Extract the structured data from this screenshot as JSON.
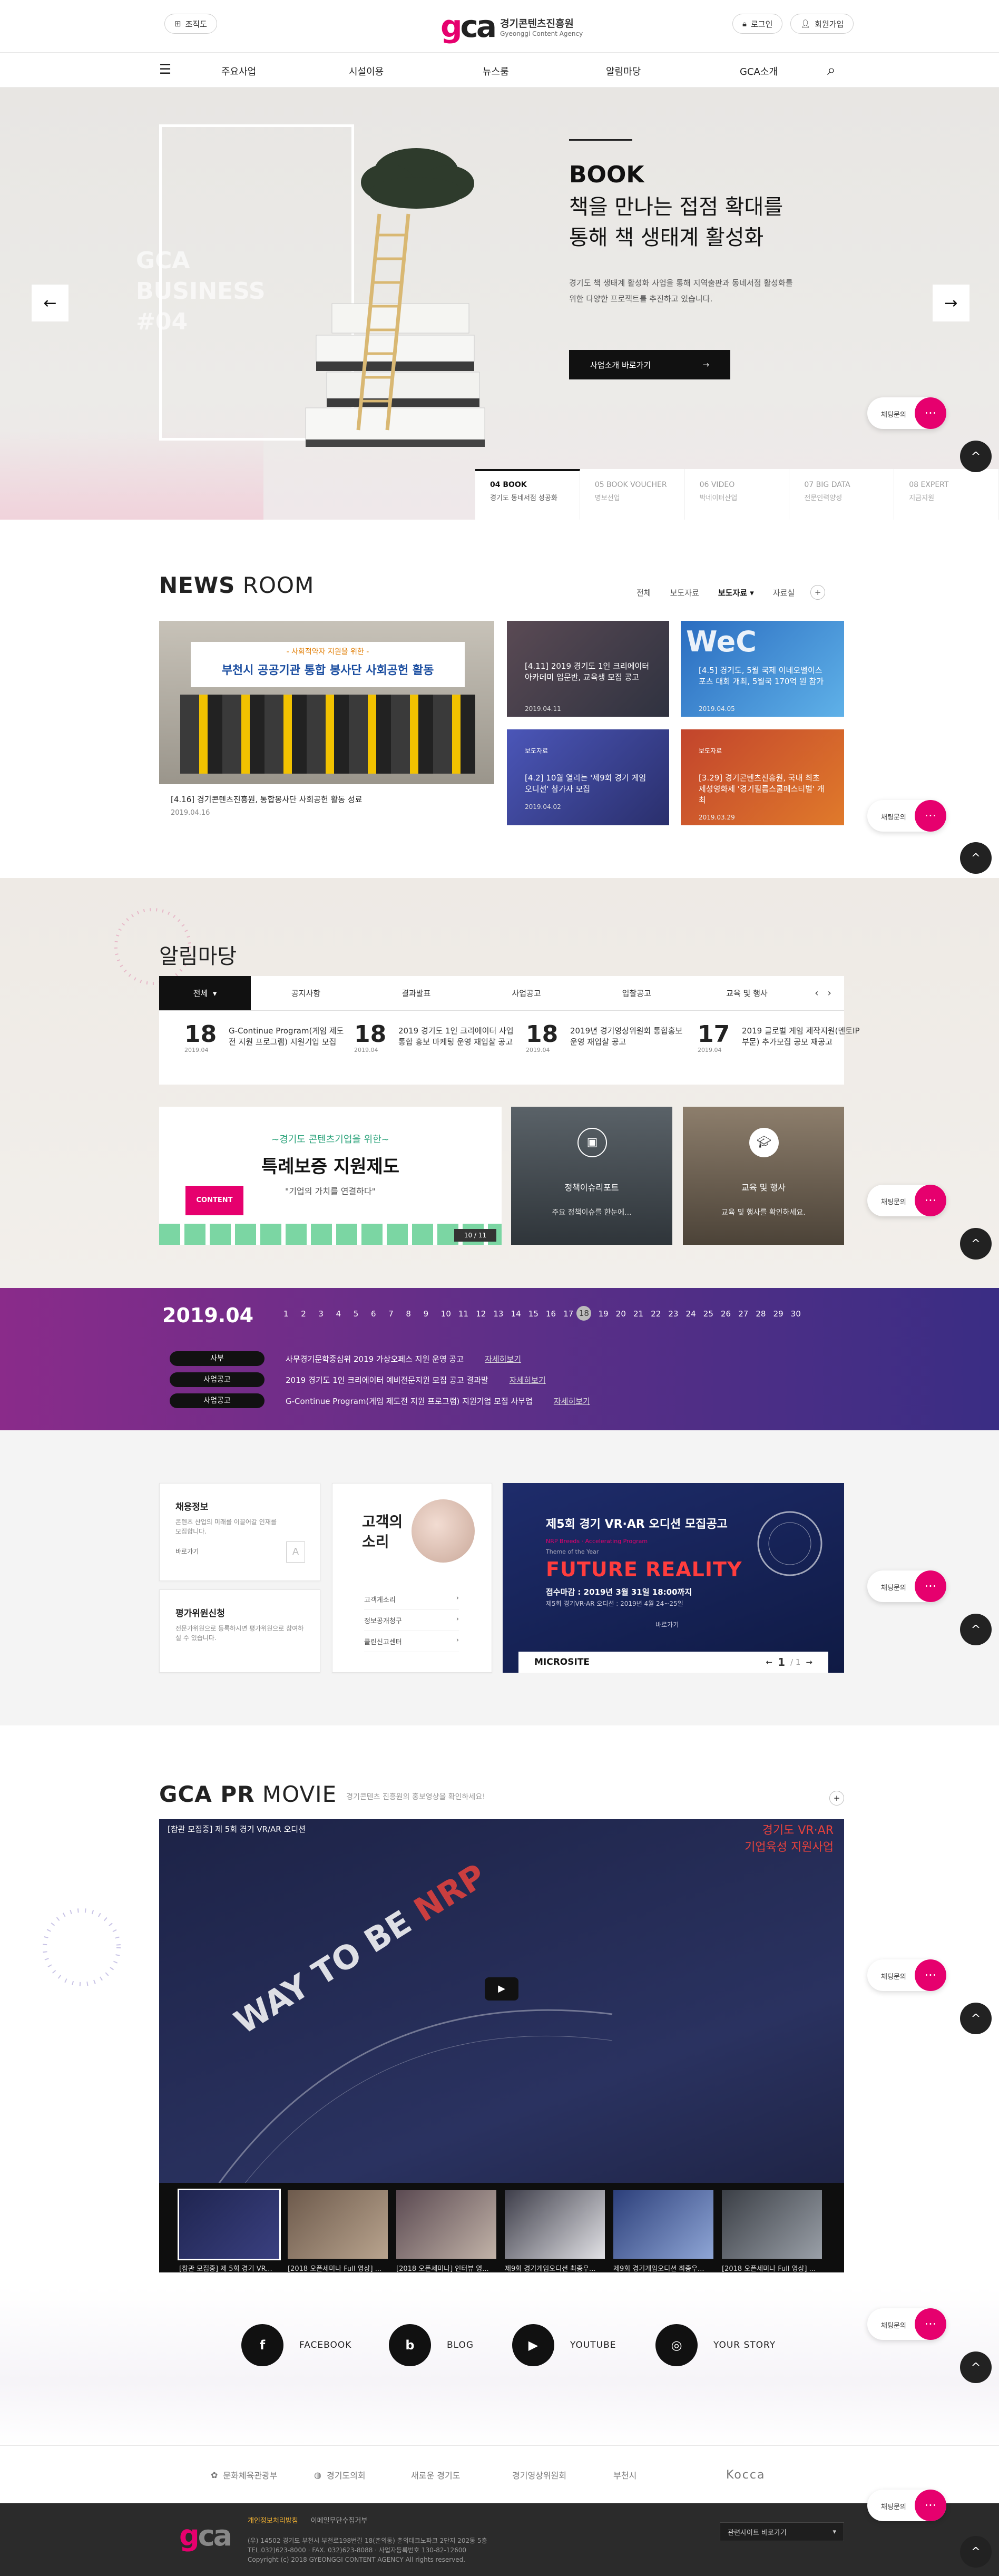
{
  "header": {
    "sitemap_label": "조직도",
    "logo_mark_g": "g",
    "logo_mark_rest": "ca",
    "logo_name": "경기콘텐츠진흥원",
    "logo_sub": "Gyeonggi Content Agency",
    "login_label": "로그인",
    "join_label": "회원가입"
  },
  "gnb": {
    "items": [
      {
        "label": "주요사업"
      },
      {
        "label": "시설이용"
      },
      {
        "label": "뉴스룸"
      },
      {
        "label": "알림마당"
      },
      {
        "label": "GCA소개"
      }
    ]
  },
  "hero": {
    "business_line1": "GCA",
    "business_line2": "BUSINESS",
    "business_line3": "#04",
    "title_en": "BOOK",
    "title_ko_1": "책을 만나는 접점 확대를",
    "title_ko_2": "통해 책 생태계 활성화",
    "desc_1": "경기도 책 생태계 활성화 사업을 통해 지역출판과 동네서점 활성화를",
    "desc_2": "위한 다양한 프로젝트를 추진하고 있습니다.",
    "cta_label": "사업소개 바로가기",
    "prev_icon": "←",
    "next_icon": "→",
    "tabs": [
      {
        "num": "04 BOOK",
        "sub": "경기도 동네서점 성공화"
      },
      {
        "num": "05 BOOK VOUCHER",
        "sub": "명보선업"
      },
      {
        "num": "06 VIDEO",
        "sub": "박네이터산업"
      },
      {
        "num": "07 BIG DATA",
        "sub": "전문인력양성"
      },
      {
        "num": "08 EXPERT",
        "sub": "지금지원"
      }
    ]
  },
  "floating": {
    "chat_label": "채팅문의",
    "chat_icon": "···",
    "top_icon": "^"
  },
  "news": {
    "title_bold": "NEWS",
    "title_rest": " ROOM",
    "tabs": [
      "전체",
      "보도자료",
      "보도자료",
      "자료실"
    ],
    "tab_active_suffix": "▾",
    "plus": "+",
    "main_card": {
      "banner_top": "- 사회적약자 지원을 위한 -",
      "banner_main": "부천시 공공기관 통합 봉사단 사회공헌 활동",
      "title": "[4.16] 경기콘텐츠진흥원, 통합봉사단 사회공헌 활동 성료",
      "date": "2019.04.16"
    },
    "cards": [
      {
        "badge": "보도자료",
        "title": "[4.11] 2019 경기도 1인 크리에이터 아카데미 입문반, 교육생 모집 공고",
        "date": "2019.04.11"
      },
      {
        "badge": "보도자료",
        "title": "[4.5] 경기도, 5월 국제 이네오벨이스포츠 대회 개최, 5월국 170억 원 참가",
        "date": "2019.04.05"
      },
      {
        "badge": "보도자료",
        "title": "[4.2] 10월 열리는 '제9회 경기 게임오디션' 참가자 모집",
        "date": "2019.04.02"
      },
      {
        "badge": "보도자료",
        "title": "[3.29] 경기콘텐츠진흥원, 국내 최초 제성영화제 '경기필름스쿨페스티벌' 개최",
        "date": "2019.03.29"
      }
    ]
  },
  "notice": {
    "title": "알림마당",
    "tabs": [
      "전체",
      "공지사항",
      "결과발표",
      "사업공고",
      "입찰공고",
      "교육 및 행사"
    ],
    "tab_active_suffix": "▾",
    "nav_prev": "‹",
    "nav_next": "›",
    "items": [
      {
        "day": "18",
        "ym": "2019.04",
        "title": "G-Continue Program(게임 제도전 지원 프로그램) 지원기업 모집"
      },
      {
        "day": "18",
        "ym": "2019.04",
        "title": "2019 경기도 1인 크리에이터 사업 통합 홍보 마케팅 운영 재입찰 공고"
      },
      {
        "day": "18",
        "ym": "2019.04",
        "title": "2019년 경기영상위원회 통합홍보 운영 재입찰 공고"
      },
      {
        "day": "17",
        "ym": "2019.04",
        "title": "2019 글로벌 게임 제작지원(멘토IP 부문) 추가모집 공모 재공고"
      }
    ],
    "banner": {
      "sub": "~경기도 콘텐츠기업을 위한~",
      "main": "특례보증 지원제도",
      "tag": "\"기업의 가치를 연결하다\"",
      "content_label": "CONTENT",
      "pager": "10 / 11"
    },
    "small_cards": [
      {
        "title": "정책이슈리포트",
        "desc": "주요 정책이슈를 한눈에..."
      },
      {
        "title": "교육 및 행사",
        "desc": "교육 및 행사를 확인하세요."
      }
    ]
  },
  "calendar": {
    "month": "2019.04",
    "days": [
      "1",
      "2",
      "3",
      "4",
      "5",
      "6",
      "7",
      "8",
      "9",
      "10",
      "11",
      "12",
      "13",
      "14",
      "15",
      "16",
      "17",
      "18",
      "19",
      "20",
      "21",
      "22",
      "23",
      "24",
      "25",
      "26",
      "27",
      "28",
      "29",
      "30"
    ],
    "selected_day": "18",
    "rows": [
      {
        "tag": "사부",
        "text": "사무경기문학중심위 2019 가상오페스 지원 운영 공고",
        "more": "자세히보기"
      },
      {
        "tag": "사업공고",
        "text": "2019 경기도 1인 크리에이터 예비전문지원 모집 공고 결과발",
        "more": "자세히보기"
      },
      {
        "tag": "사업공고",
        "text": "G-Continue Program(게임 제도전 지원 프로그램) 지원기업 모집 사부업",
        "more": "자세히보기"
      }
    ]
  },
  "quick": {
    "recruit_title": "채용정보",
    "recruit_desc": "콘텐츠 산업의 미래를 이끌어갈 인재를 모집합니다.",
    "recruit_more": "바로가기",
    "eval_title": "평가위원신청",
    "eval_desc": "전문가위원으로 등록하시면 평가위원으로 참여하실 수 있습니다.",
    "voice_title_1": "고객의",
    "voice_title_2": "소리",
    "voice_links": [
      "고객게소리",
      "정보공개청구",
      "클린신고센터"
    ],
    "micro_label": "MICROSITE",
    "micro_page": "1",
    "micro_total": "/ 1",
    "micro_prev": "←",
    "micro_next": "→",
    "micro_more": "바로가기",
    "poster_title": "제5회 경기 VR·AR 오디션 모집공고",
    "poster_tag": "NRP Breeds · Accelerating Program",
    "poster_sub": "Theme of the Year",
    "poster_big": "FUTURE REALITY",
    "poster_deadline": "접수마감 : 2019년 3월 31일 18:00까지",
    "poster_event": "제5회 경기VR·AR 오디션 : 2019년 4월 24~25일"
  },
  "pr": {
    "title_bold": "GCA PR",
    "title_rest": " MOVIE",
    "desc": "경기콘텐츠 진흥원의 홍보영상을 확인하세요!",
    "plus": "+",
    "video_caption": "[참관 모집중] 제 5회 경기 VR/AR 오디션",
    "video_corner_1": "경기도 VR·AR",
    "video_corner_2": "기업육성 지원사업",
    "video_big_1": "WAY TO BE",
    "video_big_2": "NRP",
    "play_icon": "▶",
    "thumbs": [
      "[참관 모집중] 제 5회 경기 VR...",
      "[2018 오픈세미나 Full 영상] ...",
      "[2018 오픈세미나] 인터뷰 영...",
      "제9회 경기게임오디션 최종우...",
      "제9회 경기게임오디션 최종우...",
      "[2018 오픈세미나 Full 영상] ..."
    ]
  },
  "sns": [
    {
      "label": "FACEBOOK",
      "icon": "f"
    },
    {
      "label": "BLOG",
      "icon": "b"
    },
    {
      "label": "YOUTUBE",
      "icon": "▶"
    },
    {
      "label": "YOUR STORY",
      "icon": "◎"
    }
  ],
  "partners": [
    "문화체육관광부",
    "경기도의회",
    "새로운 경기도",
    "경기영상위원회",
    "부천시",
    "Kocca"
  ],
  "footer": {
    "logo_g": "g",
    "logo_rest": "ca",
    "privacy": "개인정보처리방침",
    "email_policy": "이메일무단수집거부",
    "address": "(우) 14502 경기도 부천시 부천로198번길 18(춘의동) 춘의테크노파크 2단지 202동 5층",
    "phone": "TEL.032)623-8000 · FAX. 032)623-8088 · 사업자등록번호 130-82-12600",
    "copyright": "Copyright (c) 2018 GYEONGGI CONTENT AGENCY All rights reserved.",
    "related_label": "관련사이트 바로가기",
    "related_icon": "▾"
  }
}
